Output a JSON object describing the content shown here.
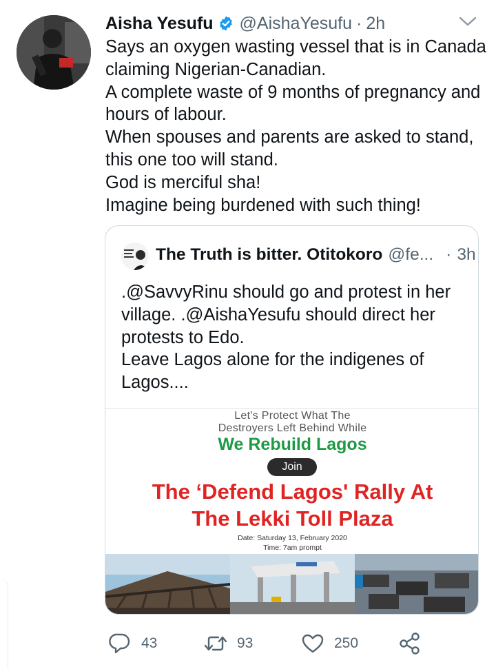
{
  "tweet": {
    "author_name": "Aisha Yesufu",
    "author_handle": "@AishaYesufu",
    "separator": "·",
    "time": "2h",
    "lines": [
      "Says an oxygen wasting vessel that is in Canada",
      "claiming Nigerian-Canadian.",
      "A complete waste of 9 months of pregnancy and",
      "hours of labour.",
      "When spouses and parents are asked to stand,",
      "this one too will stand.",
      "God is merciful sha!",
      "Imagine being burdened with such thing!"
    ]
  },
  "quote": {
    "author_name": "The Truth is bitter. Otitokoro",
    "author_handle": "@fe...",
    "separator": "·",
    "time": "3h",
    "lines": [
      ".@SavvyRinu should go and protest in her",
      "village. .@AishaYesufu should direct her",
      "protests to Edo.",
      "Leave Lagos alone for the indigenes of",
      "Lagos...."
    ],
    "poster": {
      "line1": "Let's Protect What The",
      "line2": "Destroyers Left Behind While",
      "headline_green": "We Rebuild Lagos",
      "join_label": "Join",
      "headline_red_1": "The ‘Defend Lagos' Rally At",
      "headline_red_2": "The Lekki Toll Plaza",
      "date": "Date: Saturday 13, February 2020",
      "time": "Time: 7am prompt"
    }
  },
  "actions": {
    "reply_count": "43",
    "retweet_count": "93",
    "like_count": "250"
  },
  "colors": {
    "verified": "#1d9bf0",
    "muted": "#536471",
    "green": "#1e9a45",
    "red": "#e02323"
  },
  "icons": [
    "verified-badge-icon",
    "caret-down-icon",
    "reply-icon",
    "retweet-icon",
    "like-icon",
    "share-icon"
  ]
}
